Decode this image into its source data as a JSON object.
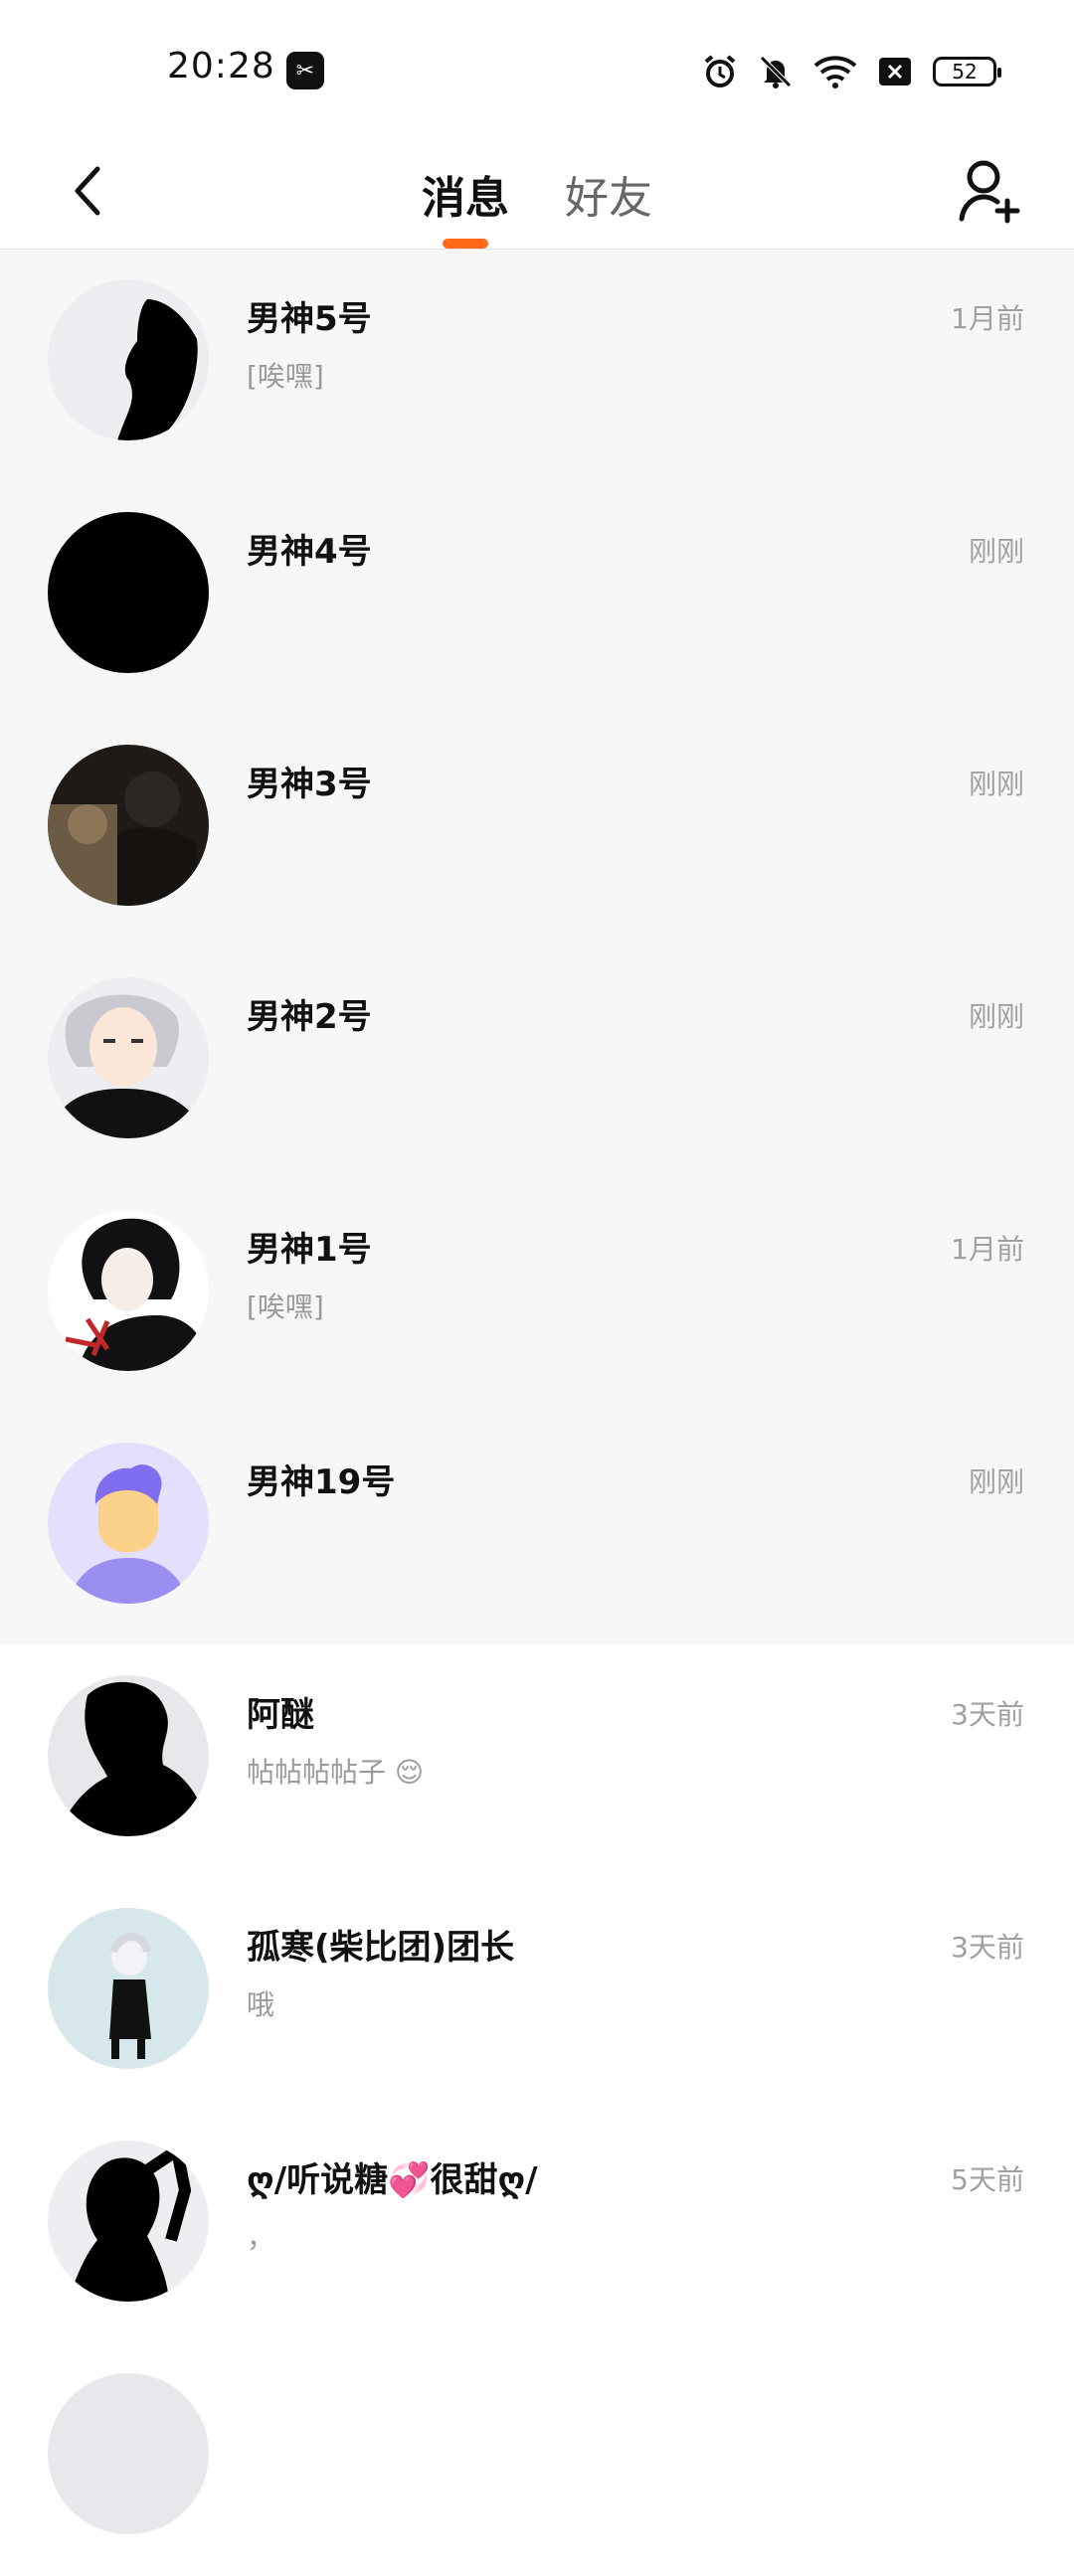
{
  "status_bar": {
    "time": "20:28",
    "app_badge": "✂",
    "battery": "52",
    "icons": [
      "alarm-icon",
      "mute-icon",
      "wifi-icon",
      "sim-off-icon",
      "battery-icon"
    ]
  },
  "header": {
    "tabs": [
      {
        "label": "消息",
        "active": true
      },
      {
        "label": "好友",
        "active": false
      }
    ]
  },
  "accent_color": "#ff6a1a",
  "conversations": [
    {
      "name": "男神5号",
      "preview": "[唉嘿]",
      "time": "1月前",
      "pinned": true
    },
    {
      "name": "男神4号",
      "preview": "",
      "time": "刚刚",
      "pinned": true
    },
    {
      "name": "男神3号",
      "preview": "",
      "time": "刚刚",
      "pinned": true
    },
    {
      "name": "男神2号",
      "preview": "",
      "time": "刚刚",
      "pinned": true
    },
    {
      "name": "男神1号",
      "preview": "[唉嘿]",
      "time": "1月前",
      "pinned": true
    },
    {
      "name": "男神19号",
      "preview": "",
      "time": "刚刚",
      "pinned": true
    },
    {
      "name": "阿醚",
      "preview": "帖帖帖帖子 😌",
      "time": "3天前",
      "pinned": false
    },
    {
      "name": "孤寒(柴比团)团长",
      "preview": "哦",
      "time": "3天前",
      "pinned": false
    },
    {
      "name": "ღ/听说糖💞很甜ღ/",
      "preview": "，",
      "time": "5天前",
      "pinned": false
    }
  ]
}
